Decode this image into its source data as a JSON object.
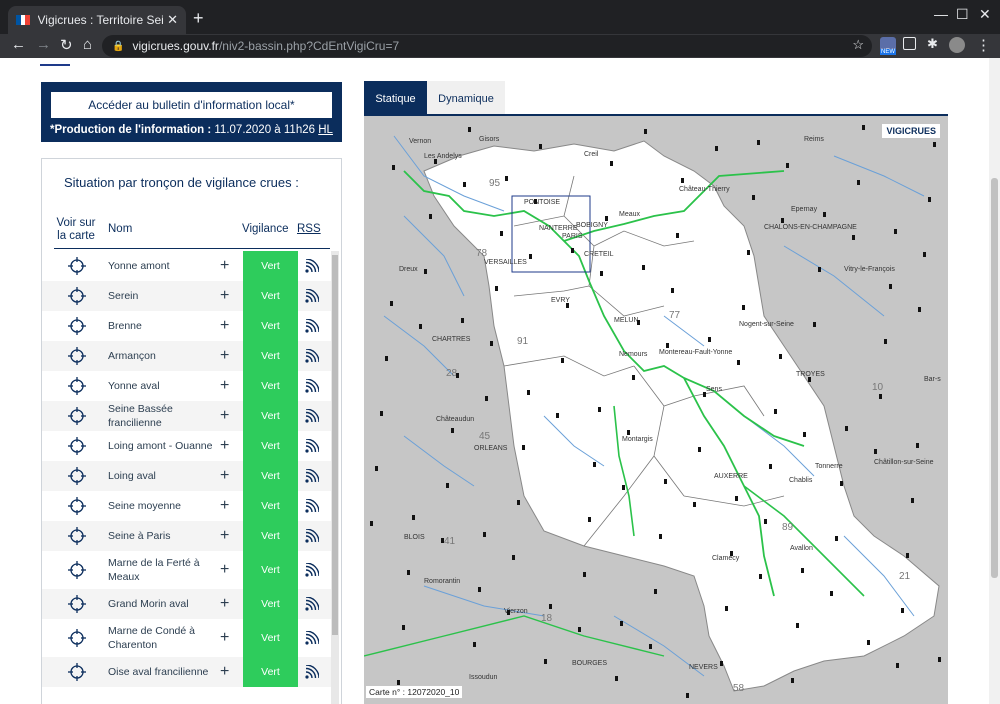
{
  "browser": {
    "tab_title": "Vigicrues : Territoire Seine mo",
    "tab_close": "✕",
    "new_tab": "+",
    "url_host": "vigicrues.gouv.fr",
    "url_path": "/niv2-bassin.php?CdEntVigiCru=7",
    "minimize": "—",
    "maximize": "☐",
    "close": "✕",
    "ext_badge": "NEW"
  },
  "info": {
    "bulletin_button": "Accéder au bulletin d'information local*",
    "production_label": "*Production de l'information :",
    "production_date": "11.07.2020 à 11h26",
    "production_tz": "HL"
  },
  "situation": {
    "title": "Situation par tronçon de vigilance crues :",
    "col_voir": "Voir sur la carte",
    "col_nom": "Nom",
    "col_vigilance": "Vigilance",
    "col_rss": "RSS",
    "rows": [
      {
        "name": "Yonne amont",
        "vigilance": "Vert"
      },
      {
        "name": "Serein",
        "vigilance": "Vert"
      },
      {
        "name": "Brenne",
        "vigilance": "Vert"
      },
      {
        "name": "Armançon",
        "vigilance": "Vert"
      },
      {
        "name": "Yonne aval",
        "vigilance": "Vert"
      },
      {
        "name": "Seine Bassée francilienne",
        "vigilance": "Vert"
      },
      {
        "name": "Loing amont - Ouanne",
        "vigilance": "Vert"
      },
      {
        "name": "Loing aval",
        "vigilance": "Vert"
      },
      {
        "name": "Seine moyenne",
        "vigilance": "Vert"
      },
      {
        "name": "Seine à Paris",
        "vigilance": "Vert"
      },
      {
        "name": "Marne de la Ferté à Meaux",
        "vigilance": "Vert"
      },
      {
        "name": "Grand Morin aval",
        "vigilance": "Vert"
      },
      {
        "name": "Marne de Condé à Charenton",
        "vigilance": "Vert"
      },
      {
        "name": "Oise aval francilienne",
        "vigilance": "Vert"
      }
    ]
  },
  "map_tabs": {
    "statique": "Statique",
    "dynamique": "Dynamique"
  },
  "map": {
    "logo": "VIGICRUES",
    "carte_number": "Carte n° : 12072020_10",
    "places": [
      "Vernon",
      "Les Andelys",
      "Gisors",
      "Creil",
      "Château-Thierry",
      "Reims",
      "Epernay",
      "CHALONS-EN-CHAMPAGNE",
      "Vitry-le-François",
      "PONTOISE",
      "NANTERRE",
      "PARIS",
      "BOBIGNY",
      "Meaux",
      "CRETEIL",
      "VERSAILLES",
      "EVRY",
      "MELUN",
      "Nogent-sur-Seine",
      "Montereau-Fault-Yonne",
      "Dreux",
      "CHARTRES",
      "Nemours",
      "Sens",
      "TROYES",
      "Bar-s",
      "Châteaudun",
      "ORLEANS",
      "Montargis",
      "AUXERRE",
      "Chablis",
      "Tonnerre",
      "Châtillon-sur-Seine",
      "BLOIS",
      "Clamecy",
      "Avallon",
      "Romorantin",
      "Vierzon",
      "BOURGES",
      "Issoudun",
      "NEVERS"
    ],
    "departments": [
      "95",
      "78",
      "77",
      "91",
      "28",
      "45",
      "10",
      "89",
      "21",
      "41",
      "18",
      "58"
    ]
  },
  "colors": {
    "navy": "#0b2d5c",
    "vert": "#2ecc5c",
    "river_green": "#2bc24a",
    "land": "#ffffff",
    "outside": "#c6c6c6"
  }
}
